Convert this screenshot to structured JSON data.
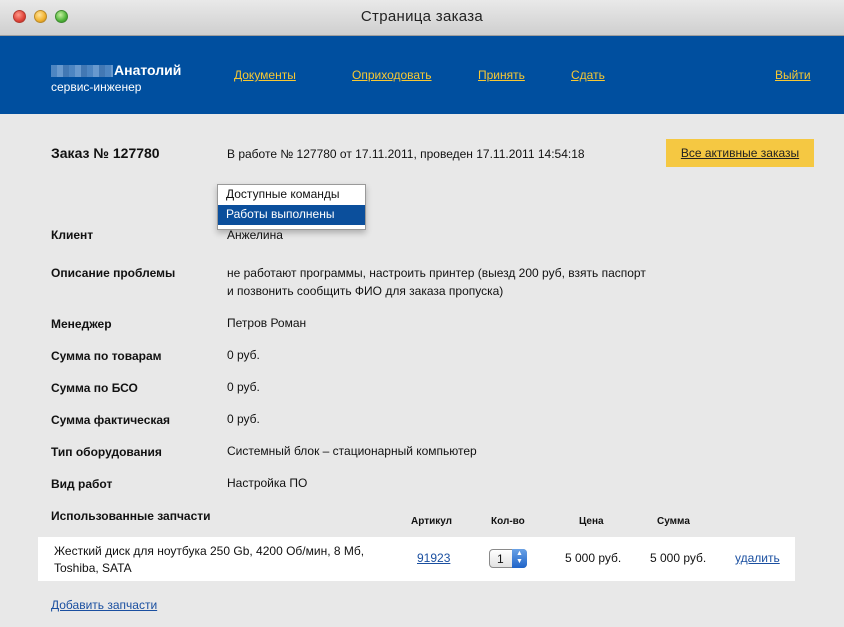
{
  "window": {
    "title": "Страница заказа"
  },
  "header": {
    "user_name": "Анатолий",
    "user_role": "сервис-инженер",
    "nav": {
      "documents": "Документы",
      "receive": "Оприходовать",
      "accept": "Принять",
      "handover": "Сдать",
      "logout": "Выйти"
    }
  },
  "order": {
    "title": "Заказ № 127780",
    "status": "В работе № 127780 от 17.11.2011, проведен 17.11.2011 14:54:18",
    "active_orders_button": "Все активные заказы"
  },
  "commands_dropdown": {
    "items": [
      "Доступные команды",
      "Работы выполнены"
    ],
    "selected_index": 1
  },
  "fields": {
    "client": {
      "label": "Клиент",
      "value": "Анжелина"
    },
    "problem": {
      "label": "Описание проблемы",
      "value_line1": "не работают программы, настроить принтер (выезд 200 руб, взять паспорт",
      "value_line2": "и позвонить сообщить ФИО для заказа пропуска)"
    },
    "manager": {
      "label": "Менеджер",
      "value": "Петров Роман"
    },
    "sum_goods": {
      "label": "Сумма по товарам",
      "value": "0 руб."
    },
    "sum_bso": {
      "label": "Сумма по БСО",
      "value": "0 руб."
    },
    "sum_actual": {
      "label": "Сумма фактическая",
      "value": "0 руб."
    },
    "equipment_type": {
      "label": "Тип оборудования",
      "value": "Системный блок – стационарный компьютер"
    },
    "work_type": {
      "label": "Вид работ",
      "value": "Настройка ПО"
    }
  },
  "parts": {
    "label": "Использованные запчасти",
    "columns": {
      "article": "Артикул",
      "qty": "Кол-во",
      "price": "Цена",
      "sum": "Сумма"
    },
    "rows": [
      {
        "name_line1": "Жесткий диск для ноутбука 250 Gb, 4200 Об/мин, 8 Мб,",
        "name_line2": "Toshiba, SATA",
        "article": "91923",
        "qty": "1",
        "price": "5 000 руб.",
        "sum": "5 000 руб.",
        "delete": "удалить"
      }
    ],
    "add_link": "Добавить запчасти"
  }
}
